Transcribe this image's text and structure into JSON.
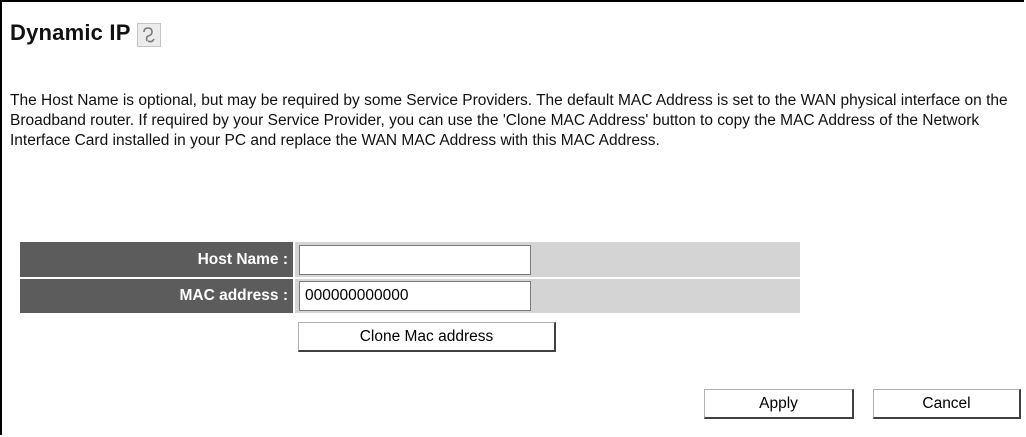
{
  "header": {
    "title": "Dynamic IP",
    "help_icon": "help-icon"
  },
  "description": "The Host Name is optional, but may be required by some Service Providers. The default MAC Address is set to the WAN physical interface on the Broadband router. If required by your Service Provider, you can use the 'Clone MAC Address' button to copy the MAC Address of the Network Interface Card installed in your PC and replace the WAN MAC Address with this MAC Address.",
  "form": {
    "host_name": {
      "label": "Host Name :",
      "value": ""
    },
    "mac_address": {
      "label": "MAC address :",
      "value": "000000000000"
    },
    "clone_button_label": "Clone Mac address"
  },
  "actions": {
    "apply_label": "Apply",
    "cancel_label": "Cancel"
  },
  "colors": {
    "label_background": "#5c5c5c",
    "field_background": "#d4d4d4",
    "label_text": "#ffffff"
  }
}
